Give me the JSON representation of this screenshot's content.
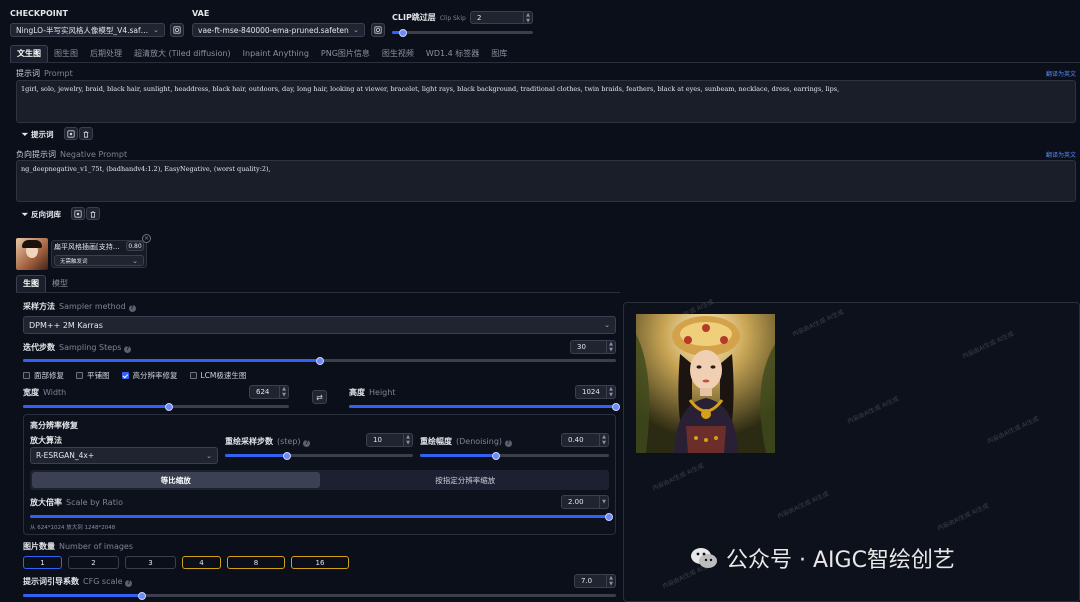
{
  "top": {
    "checkpoint_label": "CHECKPOINT",
    "checkpoint_value": "NingLO-半写实风格人像模型_V4.safetensors",
    "vae_label": "VAE",
    "vae_value": "vae-ft-mse-840000-ema-pruned.safetensors",
    "clip_label": "CLIP跳过层",
    "clip_sub": "Clip Skip",
    "clip_value": "2",
    "clip_fraction": 0.08
  },
  "tabs": [
    "文生图",
    "图生图",
    "后期处理",
    "超清放大 (Tiled diffusion)",
    "Inpaint Anything",
    "PNG图片信息",
    "图生视频",
    "WD1.4 标签器",
    "图库"
  ],
  "prompt": {
    "label": "提示词",
    "sub": "Prompt",
    "translate": "翻译为英文",
    "text": "1girl, solo, jewelry, braid, black hair, sunlight, headdress, black hair, outdoors, day, long hair, looking at viewer, bracelet, light rays, black background, traditional clothes, twin braids, feathers, black at eyes, sunbeam, necklace, dress, earrings, lips,",
    "tool_label": "提示词"
  },
  "negative": {
    "label": "负向提示词",
    "sub": "Negative Prompt",
    "translate": "翻译为英文",
    "text": "ng_deepnegative_v1_75t, (badhandv4:1.2), EasyNegative, (worst quality:2),",
    "tool_label": "反向词库"
  },
  "lora": {
    "name": "扁平风格插画[支持…",
    "weight": "0.80",
    "trigger": "无需触发词"
  },
  "subtabs": [
    "生图",
    "模型"
  ],
  "sampler": {
    "label": "采样方法",
    "sub": "Sampler method",
    "value": "DPM++ 2M Karras"
  },
  "steps": {
    "label": "迭代步数",
    "sub": "Sampling Steps",
    "value": "30",
    "fraction": 0.5
  },
  "checkboxes": [
    {
      "label": "面部修复",
      "checked": false
    },
    {
      "label": "平铺图",
      "checked": false
    },
    {
      "label": "高分辨率修复",
      "checked": true
    },
    {
      "label": "LCM极速生图",
      "checked": false
    }
  ],
  "width": {
    "label": "宽度",
    "sub": "Width",
    "value": "624",
    "fraction": 0.55
  },
  "height": {
    "label": "高度",
    "sub": "Height",
    "value": "1024",
    "fraction": 1.0
  },
  "hires": {
    "title": "高分辨率修复",
    "upscaler_label": "放大算法",
    "upscaler_value": "R-ESRGAN_4x+",
    "steps_label": "重绘采样步数",
    "steps_sub": "(step)",
    "steps_value": "10",
    "steps_fraction": 0.33,
    "denoise_label": "重绘幅度",
    "denoise_sub": "(Denoising)",
    "denoise_value": "0.40",
    "denoise_fraction": 0.4,
    "mode_a": "等比缩放",
    "mode_b": "按指定分辨率缩放",
    "scale_label": "放大倍率",
    "scale_sub": "Scale by Ratio",
    "scale_value": "2.00",
    "scale_fraction": 1.0,
    "size_note": "从 624*1024 放大到 1248*2048"
  },
  "batch": {
    "label": "图片数量",
    "sub": "Number of images",
    "options": [
      "1",
      "2",
      "3",
      "4",
      "8",
      "16"
    ]
  },
  "cfg": {
    "label": "提示词引导系数",
    "sub": "CFG scale",
    "value": "7.0",
    "fraction": 0.2
  },
  "output": {
    "watermark": "公众号 · AIGC智绘创艺",
    "tile_text": "内容由AI生成 AI生成"
  },
  "colors": {
    "accent": "#3361f3",
    "bg": "#0b0f19",
    "gold": "#d4a017"
  }
}
